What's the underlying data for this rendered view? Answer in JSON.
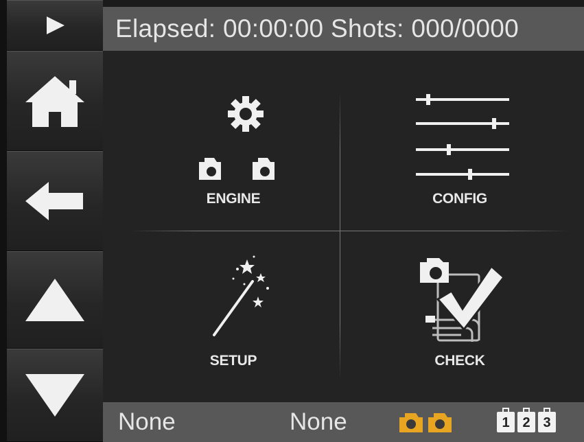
{
  "status": {
    "elapsed_label": "Elapsed:",
    "elapsed_value": "00:00:00",
    "shots_label": "Shots:",
    "shots_value": "000/0000"
  },
  "sidebar": {
    "items": [
      {
        "icon": "play-icon"
      },
      {
        "icon": "home-icon"
      },
      {
        "icon": "back-arrow-icon"
      },
      {
        "icon": "up-arrow-icon"
      },
      {
        "icon": "down-arrow-icon"
      }
    ]
  },
  "menu": {
    "tiles": [
      {
        "label": "ENGINE",
        "icon": "gear-cameras-icon"
      },
      {
        "label": "CONFIG",
        "icon": "sliders-icon"
      },
      {
        "label": "SETUP",
        "icon": "magic-wand-icon"
      },
      {
        "label": "CHECK",
        "icon": "camera-checkmark-icon"
      }
    ]
  },
  "bottom": {
    "left_text": "None",
    "middle_text": "None",
    "camera_color": "#e8a521",
    "numbers": [
      "1",
      "2",
      "3"
    ]
  },
  "colors": {
    "background": "#1b1b1b",
    "panel": "#232323",
    "bar": "#585858",
    "accent": "#e8a521"
  }
}
